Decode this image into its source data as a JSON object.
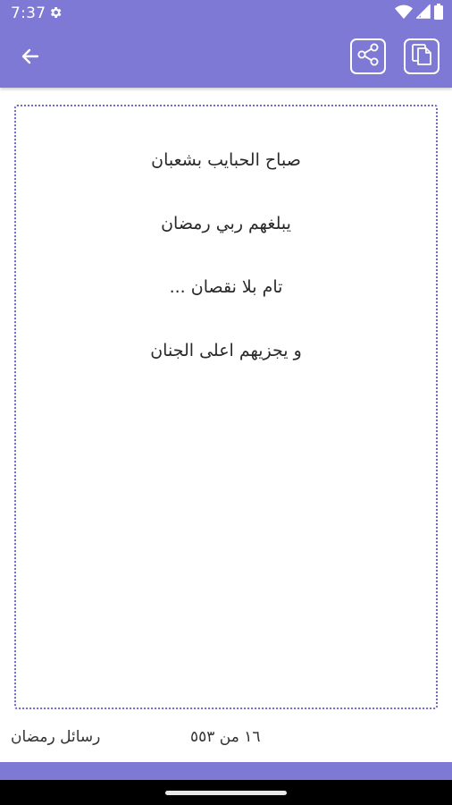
{
  "status_bar": {
    "time": "7:37",
    "icons": [
      "gear-icon",
      "wifi-icon",
      "signal-icon",
      "battery-icon"
    ]
  },
  "app_bar": {
    "icons": [
      "back-arrow-icon",
      "share-icon",
      "copy-icon"
    ]
  },
  "message": {
    "lines": [
      "صباح الحبايب بشعبان",
      "يبلغهم ربي رمضان",
      "تام بلا نقصان ...",
      "و يجزيهم اعلى الجنان"
    ]
  },
  "footer": {
    "category": "رسائل رمضان",
    "counter": "١٦ من ٥٥٣"
  },
  "colors": {
    "accent": "#7e79d5",
    "card_border": "#6e69cf",
    "text": "#2a2a2a"
  }
}
